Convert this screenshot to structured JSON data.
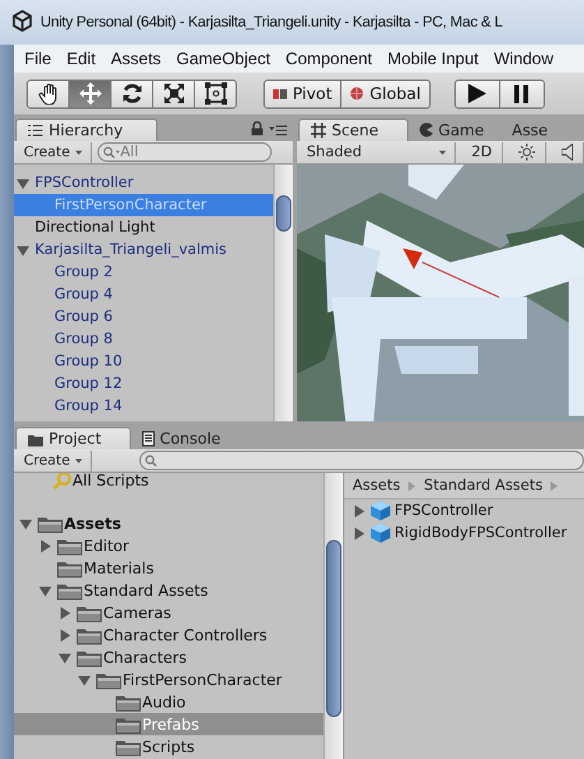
{
  "window": {
    "title": "Unity Personal (64bit) - Karjasilta_Triangeli.unity - Karjasilta - PC, Mac & L"
  },
  "menu": [
    "File",
    "Edit",
    "Assets",
    "GameObject",
    "Component",
    "Mobile Input",
    "Window"
  ],
  "tools": [
    {
      "kind": "hand",
      "selected": false
    },
    {
      "kind": "move",
      "selected": true
    },
    {
      "kind": "rotate",
      "selected": false
    },
    {
      "kind": "scale",
      "selected": false
    },
    {
      "kind": "rect",
      "selected": false
    }
  ],
  "pivot_buttons": [
    {
      "kind": "pivot",
      "label": "Pivot"
    },
    {
      "kind": "global",
      "label": "Global"
    }
  ],
  "playback": [
    {
      "kind": "play"
    },
    {
      "kind": "pause"
    }
  ],
  "hierarchy": {
    "tab": {
      "label": "Hierarchy",
      "selected": true
    },
    "create": "Create",
    "search": {
      "placeholder": "All"
    },
    "items": [
      {
        "label": "FPSController",
        "kind": "prefab",
        "selected": false,
        "expanded": true,
        "children": [
          {
            "label": "FirstPersonCharacter",
            "kind": "prefab",
            "selected": true
          }
        ]
      },
      {
        "label": "Directional Light",
        "kind": "object",
        "selected": false
      },
      {
        "label": "Karjasilta_Triangeli_valmis",
        "kind": "prefab",
        "selected": false,
        "expanded": true,
        "children": [
          {
            "label": "Group 2",
            "kind": "prefab",
            "selected": false
          },
          {
            "label": "Group 4",
            "kind": "prefab",
            "selected": false
          },
          {
            "label": "Group 6",
            "kind": "prefab",
            "selected": false
          },
          {
            "label": "Group 8",
            "kind": "prefab",
            "selected": false
          },
          {
            "label": "Group 10",
            "kind": "prefab",
            "selected": false
          },
          {
            "label": "Group 12",
            "kind": "prefab",
            "selected": false
          },
          {
            "label": "Group 14",
            "kind": "prefab",
            "selected": false
          }
        ]
      }
    ]
  },
  "scene": {
    "tabs": [
      {
        "kind": "scene",
        "label": "Scene",
        "selected": true
      },
      {
        "kind": "game",
        "label": "Game",
        "selected": false
      },
      {
        "kind": "plain",
        "label": "Asse",
        "selected": false
      }
    ],
    "draw_mode": "Shaded",
    "mode_2d": {
      "label": "2D",
      "on": false
    },
    "toggles": [
      {
        "kind": "lighting",
        "on": false
      },
      {
        "kind": "audio",
        "on": false
      }
    ]
  },
  "project": {
    "tabs": [
      {
        "kind": "project",
        "label": "Project",
        "selected": true
      },
      {
        "kind": "console",
        "label": "Console",
        "selected": false
      }
    ],
    "create": "Create",
    "favorites": [
      {
        "label": "All Scripts",
        "selected": false
      }
    ],
    "tree": [
      {
        "label": "Assets",
        "selected": false,
        "expanded": true,
        "children": [
          {
            "label": "Editor",
            "selected": false,
            "expanded": false
          },
          {
            "label": "Materials",
            "selected": false
          },
          {
            "label": "Standard Assets",
            "selected": false,
            "expanded": true,
            "children": [
              {
                "label": "Cameras",
                "selected": false,
                "expanded": false
              },
              {
                "label": "Character Controllers",
                "selected": false,
                "expanded": false
              },
              {
                "label": "Characters",
                "selected": false,
                "expanded": true,
                "children": [
                  {
                    "label": "FirstPersonCharacter",
                    "selected": false,
                    "expanded": true,
                    "children": [
                      {
                        "label": "Audio",
                        "selected": false
                      },
                      {
                        "label": "Prefabs",
                        "selected": true
                      },
                      {
                        "label": "Scripts",
                        "selected": false
                      }
                    ]
                  }
                ]
              }
            ]
          }
        ]
      }
    ],
    "breadcrumb": [
      "Assets",
      "Standard Assets"
    ],
    "assets": [
      {
        "label": "FPSController",
        "expanded": false
      },
      {
        "label": "RigidBodyFPSController",
        "expanded": false
      }
    ]
  }
}
